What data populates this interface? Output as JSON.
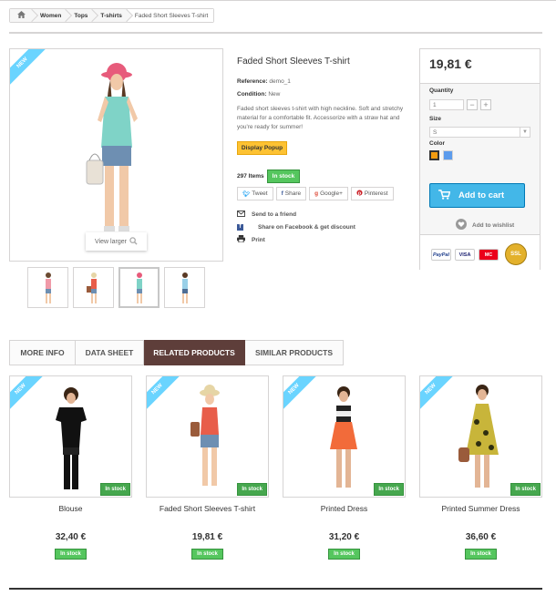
{
  "breadcrumb": {
    "home_icon": "home-icon",
    "items": [
      "Women",
      "Tops",
      "T-shirts"
    ],
    "current": "Faded Short Sleeves T-shirt"
  },
  "product": {
    "ribbon": "NEW",
    "view_larger": "View larger",
    "title": "Faded Short Sleeves T-shirt",
    "reference_label": "Reference:",
    "reference_value": "demo_1",
    "condition_label": "Condition:",
    "condition_value": "New",
    "description": "Faded short sleeves t-shirt with high neckline. Soft and stretchy material for a comfortable fit. Accessorize with a straw hat and you're ready for summer!",
    "popup_label": "Display Popup",
    "quantity_text": "297 Items",
    "stock_status": "In stock",
    "social": {
      "tweet": "Tweet",
      "share": "Share",
      "google": "Google+",
      "pinterest": "Pinterest"
    },
    "links": {
      "friend": "Send to a friend",
      "facebook": "Share on Facebook & get discount",
      "print": "Print"
    }
  },
  "buybox": {
    "price": "19,81 €",
    "quantity_label": "Quantity",
    "quantity_value": "1",
    "minus": "−",
    "plus": "+",
    "size_label": "Size",
    "size_value": "S",
    "color_label": "Color",
    "colors": [
      "#f39c11",
      "#5d9cec"
    ],
    "cart_label": "Add to cart",
    "wishlist_label": "Add to wishlist",
    "payment": [
      "PayPal",
      "VISA",
      "MC",
      "SSL"
    ]
  },
  "tabs": [
    "MORE INFO",
    "DATA SHEET",
    "RELATED PRODUCTS",
    "SIMILAR PRODUCTS"
  ],
  "active_tab": "RELATED PRODUCTS",
  "related": [
    {
      "name": "Blouse",
      "price": "32,40 €",
      "stock": "In stock",
      "ribbon": "NEW",
      "img_stock": "In stock"
    },
    {
      "name": "Faded Short Sleeves T-shirt",
      "price": "19,81 €",
      "stock": "In stock",
      "ribbon": "NEW",
      "img_stock": "In stock"
    },
    {
      "name": "Printed Dress",
      "price": "31,20 €",
      "stock": "In stock",
      "ribbon": "NEW",
      "img_stock": "In stock"
    },
    {
      "name": "Printed Summer Dress",
      "price": "36,60 €",
      "stock": "In stock",
      "ribbon": "NEW",
      "img_stock": "In stock"
    }
  ]
}
